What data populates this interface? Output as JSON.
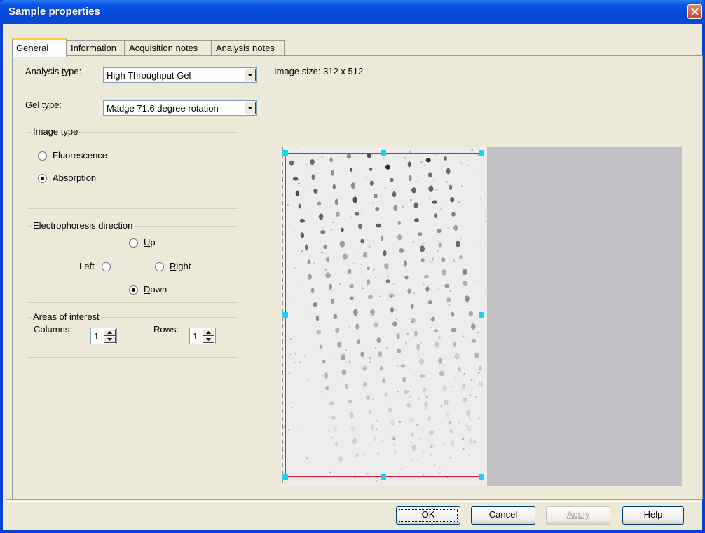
{
  "window": {
    "title": "Sample properties"
  },
  "tabs": [
    {
      "label": "General",
      "active": true
    },
    {
      "label": "Information",
      "active": false
    },
    {
      "label": "Acquisition notes",
      "active": false
    },
    {
      "label": "Analysis notes",
      "active": false
    }
  ],
  "general": {
    "analysis_type": {
      "label_pre": "Analysis ",
      "label_u": "t",
      "label_post": "ype:",
      "value": "High Throughput Gel"
    },
    "gel_type": {
      "label": "Gel type:",
      "value": "Madge 71.6 degree rotation"
    },
    "image_size": "Image size: 312 x 512",
    "image_type": {
      "title": "Image type",
      "options": [
        {
          "label": "Fluorescence",
          "selected": false
        },
        {
          "label": "Absorption",
          "selected": true
        }
      ]
    },
    "electrophoresis": {
      "title": "Electrophoresis direction",
      "up": {
        "u": "U",
        "rest": "p",
        "selected": false
      },
      "left": {
        "label": "Left",
        "selected": false
      },
      "right": {
        "u": "R",
        "rest": "ight",
        "selected": false
      },
      "down": {
        "u": "D",
        "rest": "own",
        "selected": true
      }
    },
    "areas": {
      "title": "Areas of interest",
      "columns_label": "Columns:",
      "columns_value": "1",
      "rows_label": "Rows:",
      "rows_value": "1"
    }
  },
  "buttons": {
    "ok": "OK",
    "cancel": "Cancel",
    "apply": "Apply",
    "help": "Help"
  },
  "colors": {
    "roi_border": "#e8202a",
    "roi_handle": "#19d3f0",
    "title_bar": "#0447d6"
  }
}
